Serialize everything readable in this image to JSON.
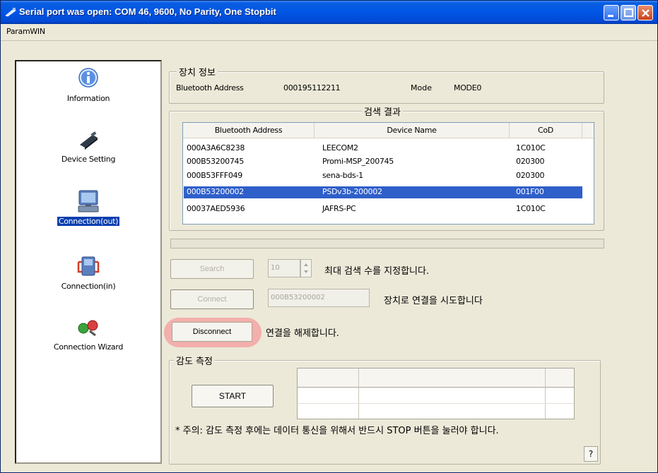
{
  "window": {
    "title": "Serial port was open: COM 46, 9600, No Parity, One Stopbit"
  },
  "menu": {
    "items": [
      "ParamWIN"
    ]
  },
  "nav": {
    "items": [
      {
        "label": "Information",
        "icon": "info-icon"
      },
      {
        "label": "Device Setting",
        "icon": "device-icon"
      },
      {
        "label": "Connection(out)",
        "icon": "computer-icon",
        "selected": true
      },
      {
        "label": "Connection(in)",
        "icon": "connection-in-icon"
      },
      {
        "label": "Connection Wizard",
        "icon": "wizard-icon"
      }
    ]
  },
  "device_info": {
    "legend": "장치 정보",
    "address_label": "Bluetooth Address",
    "address_value": "000195112211",
    "mode_label": "Mode",
    "mode_value": "MODE0"
  },
  "search_result": {
    "legend": "검색 결과",
    "columns": [
      "Bluetooth Address",
      "Device Name",
      "CoD"
    ],
    "rows": [
      {
        "address": "000A3A6C8238",
        "name": "LEECOM2",
        "cod": "1C010C"
      },
      {
        "address": "000B53200745",
        "name": "Promi-MSP_200745",
        "cod": "020300"
      },
      {
        "address": "000B53FFF049",
        "name": "sena-bds-1",
        "cod": "020300"
      },
      {
        "address": "000B53200002",
        "name": "PSDv3b-200002",
        "cod": "001F00",
        "selected": true
      },
      {
        "address": "00037AED5936",
        "name": "JAFRS-PC",
        "cod": "1C010C"
      }
    ]
  },
  "controls": {
    "search_label": "Search",
    "search_count": "10",
    "search_hint": "최대 검색 수를 지정합니다.",
    "connect_label": "Connect",
    "connect_address": "000B53200002",
    "connect_hint": "장치로 연결을 시도합니다",
    "disconnect_label": "Disconnect",
    "disconnect_hint": "연결을 해제합니다."
  },
  "sensitivity": {
    "legend": "감도 측정",
    "start_label": "START",
    "note": "* 주의: 감도 측정 후에는 데이터 통신을 위해서 반드시 STOP 버튼을 눌러야 합니다."
  },
  "help": {
    "label": "?"
  },
  "colors": {
    "title_bar": "#0055e5",
    "selection": "#2f5fc9",
    "highlight_circle": "#f2a1a1",
    "window_bg": "#ece9d8"
  }
}
